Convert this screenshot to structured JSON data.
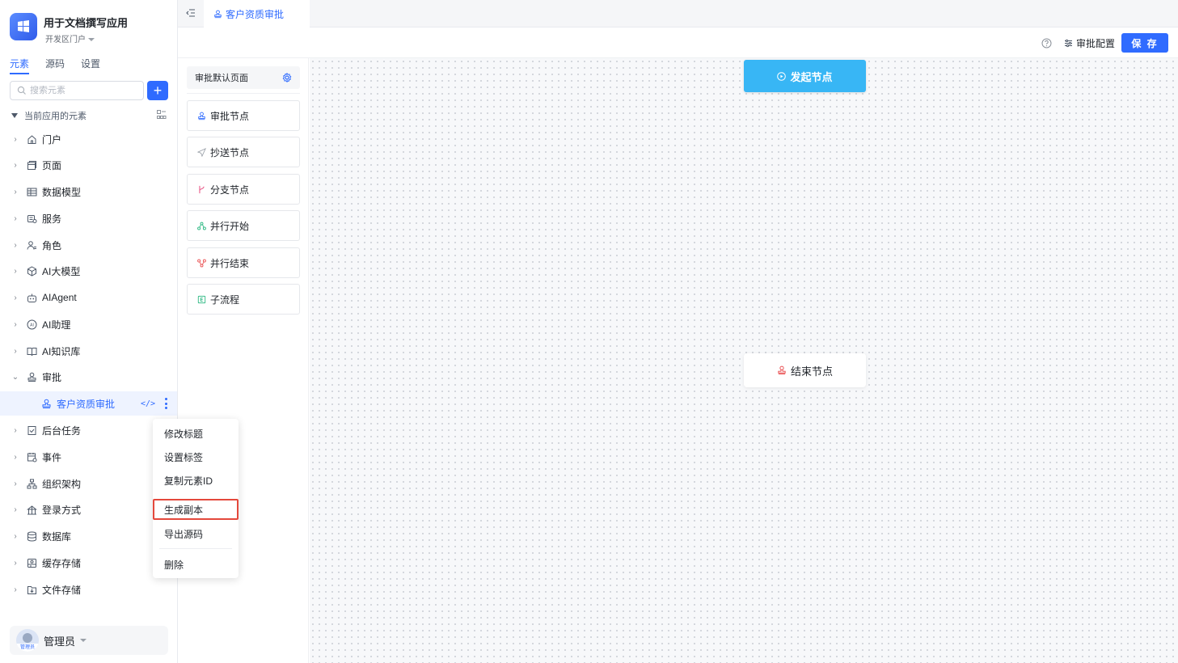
{
  "app": {
    "title": "用于文档撰写应用",
    "portal": "开发区门户"
  },
  "sidebar": {
    "tabs": [
      "元素",
      "源码",
      "设置"
    ],
    "search_placeholder": "搜索元素",
    "add_label": "+",
    "section_title": "当前应用的元素",
    "items": [
      {
        "label": "门户",
        "icon": "home-icon"
      },
      {
        "label": "页面",
        "icon": "page-icon"
      },
      {
        "label": "数据模型",
        "icon": "table-icon"
      },
      {
        "label": "服务",
        "icon": "service-icon"
      },
      {
        "label": "角色",
        "icon": "role-icon"
      },
      {
        "label": "AI大模型",
        "icon": "model-icon"
      },
      {
        "label": "AIAgent",
        "icon": "robot-icon"
      },
      {
        "label": "AI助理",
        "icon": "ai-assistant-icon"
      },
      {
        "label": "AI知识库",
        "icon": "book-icon"
      },
      {
        "label": "审批",
        "icon": "stamp-icon"
      },
      {
        "label": "客户资质审批",
        "icon": "stamp-icon"
      },
      {
        "label": "后台任务",
        "icon": "task-icon"
      },
      {
        "label": "事件",
        "icon": "event-icon"
      },
      {
        "label": "组织架构",
        "icon": "org-icon"
      },
      {
        "label": "登录方式",
        "icon": "login-icon"
      },
      {
        "label": "数据库",
        "icon": "database-icon"
      },
      {
        "label": "缓存存储",
        "icon": "cache-icon"
      },
      {
        "label": "文件存储",
        "icon": "file-icon"
      }
    ],
    "user": {
      "name": "管理员",
      "avatar_tag": "管理员"
    }
  },
  "tabbar": {
    "active_tab": "客户资质审批"
  },
  "toolbar": {
    "config_label": "审批配置",
    "save_label": "保 存"
  },
  "palette": {
    "header": "审批默认页面",
    "nodes": [
      {
        "label": "审批节点",
        "color": "#2f6bff"
      },
      {
        "label": "抄送节点",
        "color": "#9aa0a8"
      },
      {
        "label": "分支节点",
        "color": "#e85d8c"
      },
      {
        "label": "并行开始",
        "color": "#1fb37a"
      },
      {
        "label": "并行结束",
        "color": "#e8484a"
      },
      {
        "label": "子流程",
        "color": "#1fb37a"
      }
    ]
  },
  "canvas": {
    "start_label": "发起节点",
    "end_label": "结束节点",
    "start_color": "#38b6f5"
  },
  "context_menu": {
    "items": [
      "修改标题",
      "设置标签",
      "复制元素ID",
      "生成副本",
      "导出源码",
      "删除"
    ],
    "highlighted": "生成副本"
  }
}
